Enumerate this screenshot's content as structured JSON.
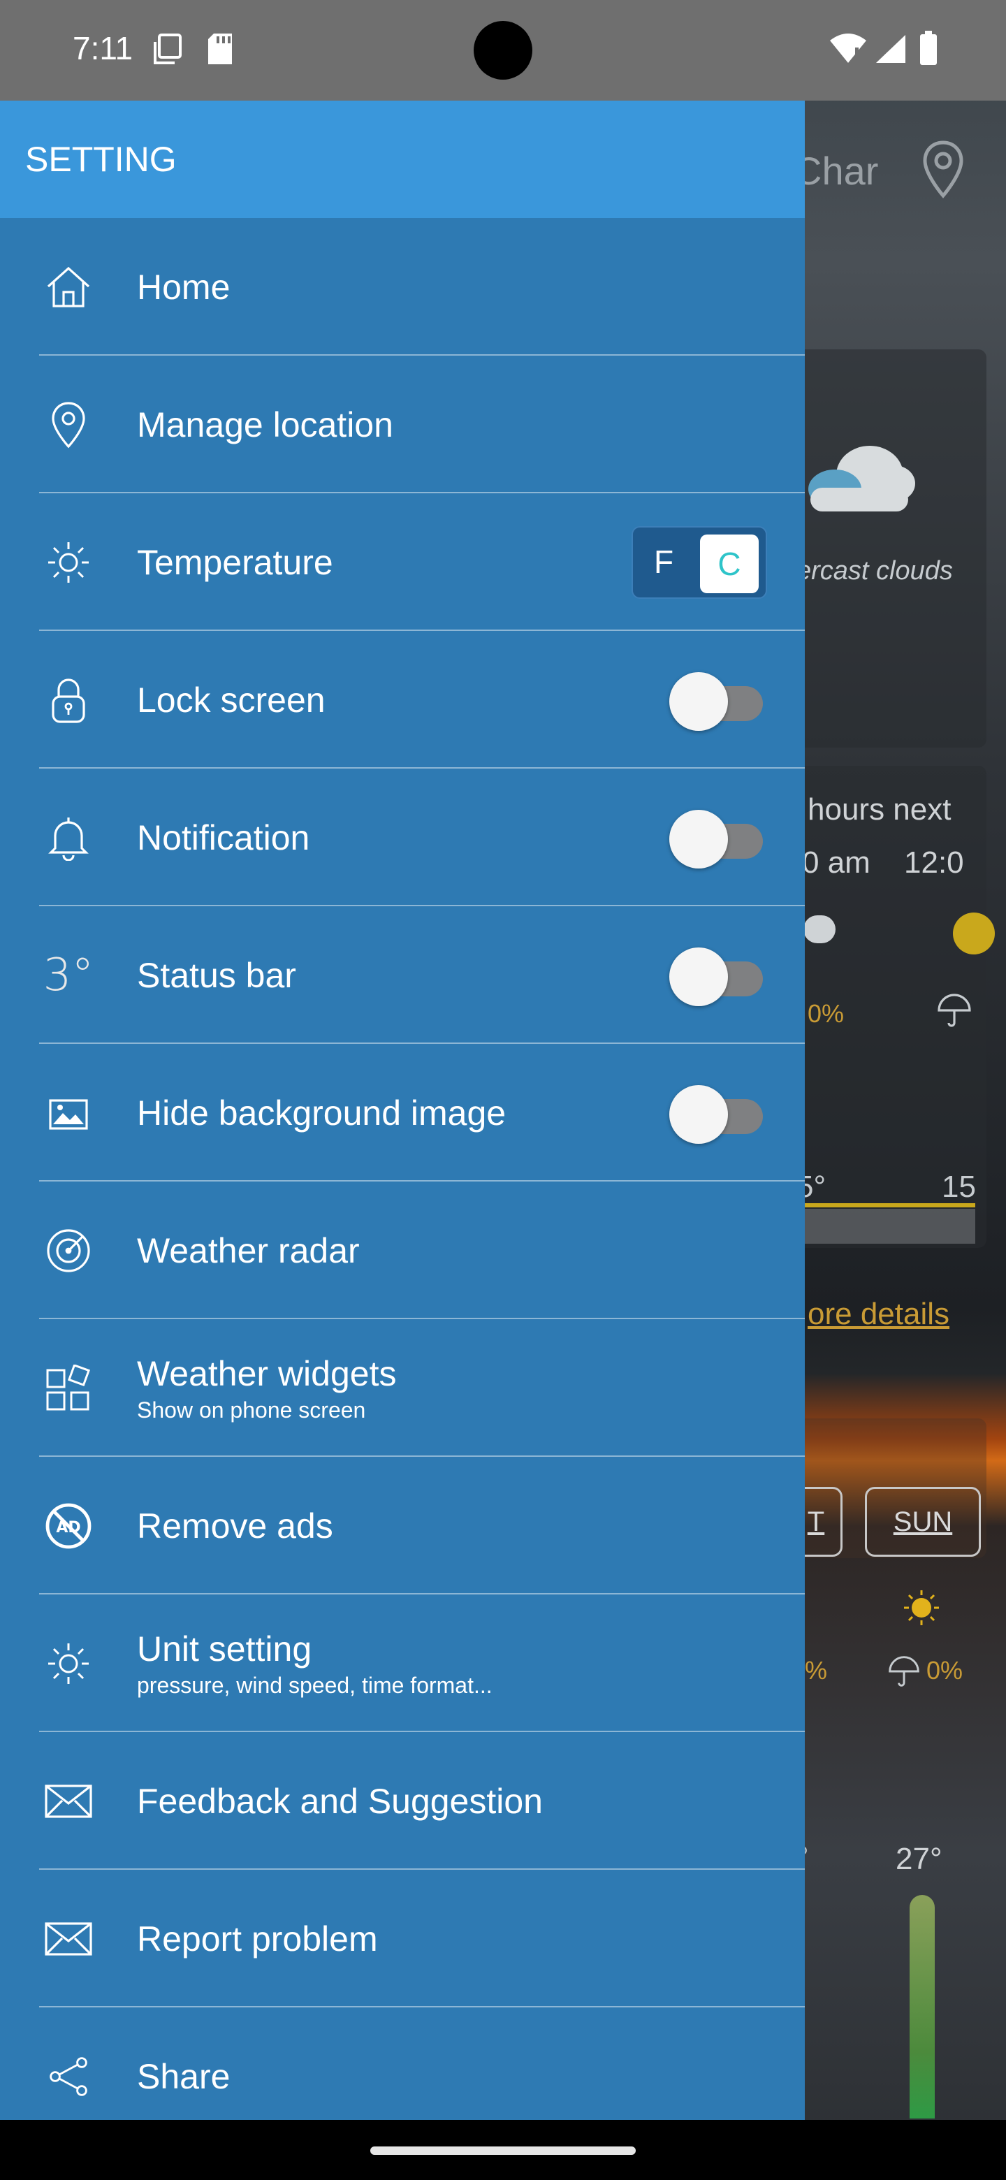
{
  "status_bar": {
    "time": "7:11"
  },
  "drawer": {
    "title": "SETTING",
    "items": [
      {
        "label": "Home",
        "sub": "",
        "icon": "home-icon",
        "control": "none"
      },
      {
        "label": "Manage location",
        "sub": "",
        "icon": "location-pin-icon",
        "control": "none"
      },
      {
        "label": "Temperature",
        "sub": "",
        "icon": "sun-icon",
        "control": "unit-switch"
      },
      {
        "label": "Lock screen",
        "sub": "",
        "icon": "lock-icon",
        "control": "toggle",
        "on": false
      },
      {
        "label": "Notification",
        "sub": "",
        "icon": "bell-icon",
        "control": "toggle",
        "on": false
      },
      {
        "label": "Status bar",
        "sub": "",
        "icon": "temperature-3-icon",
        "control": "toggle",
        "on": false
      },
      {
        "label": "Hide background image",
        "sub": "",
        "icon": "image-icon",
        "control": "toggle",
        "on": false
      },
      {
        "label": "Weather radar",
        "sub": "",
        "icon": "radar-icon",
        "control": "none"
      },
      {
        "label": "Weather widgets",
        "sub": "Show on phone screen",
        "icon": "widgets-icon",
        "control": "none"
      },
      {
        "label": "Remove ads",
        "sub": "",
        "icon": "no-ads-icon",
        "control": "none"
      },
      {
        "label": "Unit setting",
        "sub": "pressure, wind speed, time format...",
        "icon": "gear-sun-icon",
        "control": "none"
      },
      {
        "label": "Feedback and Suggestion",
        "sub": "",
        "icon": "mail-icon",
        "control": "none"
      },
      {
        "label": "Report problem",
        "sub": "",
        "icon": "mail-icon",
        "control": "none"
      },
      {
        "label": "Share",
        "sub": "",
        "icon": "share-icon",
        "control": "none"
      }
    ],
    "temperature_unit": {
      "f_label": "F",
      "c_label": "C",
      "selected": "C"
    },
    "status_bar_icon_text": "3°"
  },
  "background": {
    "header_text": "Char",
    "condition": "ercast clouds",
    "hours_title": "hours next",
    "hour_1": "0 am",
    "hour_2": "12:0",
    "precip_1": "0%",
    "temp_partial_1": "5°",
    "temp_partial_2": "15",
    "more_details": "ore details",
    "day_partial": "T",
    "day_sun": "SUN",
    "precip_2": "%",
    "precip_3": "0%",
    "temp_partial_3": "°",
    "temp_high": "27°"
  },
  "colors": {
    "drawer": "#2e7ab3",
    "drawer_header": "#3a97db",
    "status_bar": "#6f6f6f"
  }
}
